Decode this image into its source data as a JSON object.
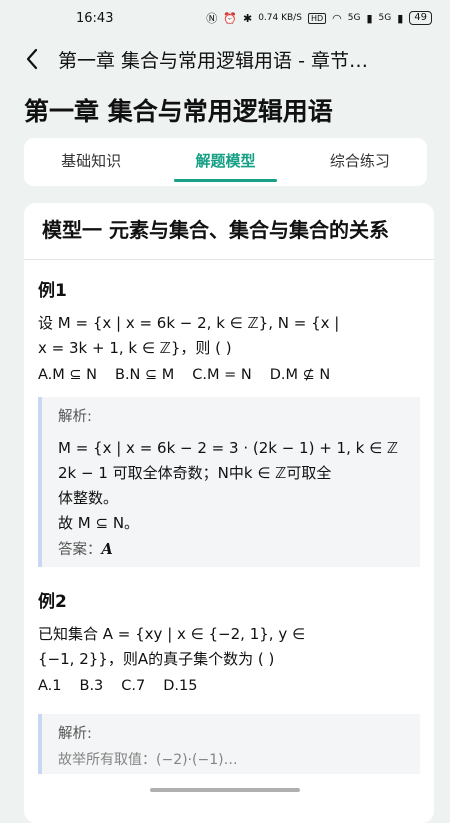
{
  "status": {
    "time": "16:43",
    "net_speed": "0.74 KB/S",
    "hd": "HD",
    "signal1": "5G",
    "signal2": "5G",
    "battery": "49"
  },
  "nav": {
    "title": "第一章 集合与常用逻辑用语 - 章节…"
  },
  "chapter": {
    "title": "第一章 集合与常用逻辑用语"
  },
  "tabs": [
    {
      "label": "基础知识"
    },
    {
      "label": "解题模型"
    },
    {
      "label": "综合练习"
    }
  ],
  "content": {
    "model_title": "模型一 元素与集合、集合与集合的关系",
    "examples": [
      {
        "title": "例1",
        "question_line1": "设 M = {x | x = 6k − 2, k ∈ ℤ}, N = {x |",
        "question_line2": "x = 3k + 1, k ∈ ℤ}，则 ( )",
        "options": [
          "A.M ⊆ N",
          "B.N ⊆ M",
          "C.M = N",
          "D.M ⊈ N"
        ],
        "solution_label": "解析:",
        "solution_line1": "M = {x | x = 6k − 2 = 3 · (2k − 1) + 1, k ∈ ℤ",
        "solution_line2": "2k − 1 可取全体奇数；N中k ∈ ℤ可取全",
        "solution_line3": "体整数。",
        "solution_line4": "故 M ⊆ N。",
        "answer_label": "答案：",
        "answer_value": "A"
      },
      {
        "title": "例2",
        "question_line1": "已知集合 A = {xy | x ∈ {−2, 1}, y ∈",
        "question_line2": "{−1, 2}}，则A的真子集个数为 ( )",
        "options": [
          "A.1",
          "B.3",
          "C.7",
          "D.15"
        ],
        "solution_label": "解析:",
        "solution_partial": "故举所有取值：(−2)·(−1)…"
      }
    ]
  }
}
